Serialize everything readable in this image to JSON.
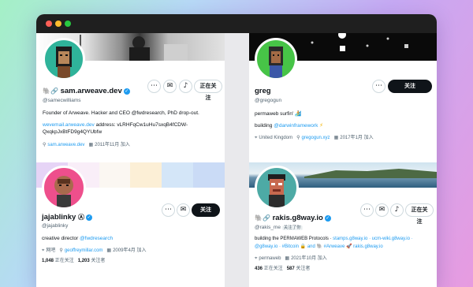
{
  "colors": {
    "accent": "#1d9bf0",
    "text": "#0f1419",
    "muted": "#536471",
    "follow_button": "#0f1419"
  },
  "cards": {
    "sam": {
      "display_name": "sam.arweave.dev",
      "name_prefix": "🐘🔗",
      "handle": "@samecwilliams",
      "bio": "Founder of Arweave. Hacker and CEO @fwdresearch, PhD drop-out.",
      "bio_mention": "@fwdresearch",
      "address_link": "wevemail.arweave.dev",
      "address_text": "address: vLRHFqCw1uHu7sxqB4fCDW-",
      "address_line2": "QxqkpJxBtFD9g4QYUbfw",
      "website": "sam.arweave.dev",
      "joined": "2011年11月 加入",
      "follow_status": "正在关注",
      "icons": [
        "more-icon",
        "message-icon",
        "notification-bell-icon",
        "link-icon",
        "calendar-icon"
      ]
    },
    "greg": {
      "display_name": "greg",
      "handle": "@gregogun",
      "bio": "permaweb surfin' 🏄",
      "building_prefix": "building",
      "building_link": "@darwinframework",
      "location": "United Kingdom",
      "website": "gregogun.xyz",
      "joined": "2017年1月 加入",
      "follow_button": "关注",
      "icons": [
        "more-icon",
        "location-icon",
        "link-icon",
        "calendar-icon"
      ]
    },
    "jaja": {
      "display_name": "jajablinky",
      "name_suffix": "Ⓐ",
      "handle": "@jajablinky",
      "bio_prefix": "creative director",
      "bio_mention": "@fwdresearch",
      "location": "网吧",
      "website": "geoffreymillar.com",
      "joined": "2009年4月 加入",
      "following_count": "1,048",
      "following_label": "正在关注",
      "followers_count": "1,203",
      "followers_label": "关注者",
      "follow_button": "关注",
      "icons": [
        "more-icon",
        "message-icon",
        "location-icon",
        "link-icon",
        "calendar-icon"
      ]
    },
    "rakis": {
      "display_name": "rakis.g8way.io",
      "name_prefix": "🐘🔗",
      "handle": "@rakis_me",
      "follows_you": "关注了你",
      "bio_line1_prefix": "building the PERMAWEB Protocols ·",
      "bio_line1_links": "stamps.g8way.io · ucm-wiki.g8way.io ·",
      "bio_line2_link1": "@g8way.io",
      "bio_line2_tags": "· #Bitcoin 🔒 and 🐘 #Arweave 🚀",
      "bio_line2_link2": "rakis.g8way.io",
      "location": "permaweb",
      "joined": "2021年10月 加入",
      "following_count": "436",
      "following_label": "正在关注",
      "followers_count": "587",
      "followers_label": "关注者",
      "follow_status": "正在关注",
      "icons": [
        "more-icon",
        "message-icon",
        "notification-bell-icon",
        "location-icon",
        "calendar-icon"
      ]
    }
  }
}
